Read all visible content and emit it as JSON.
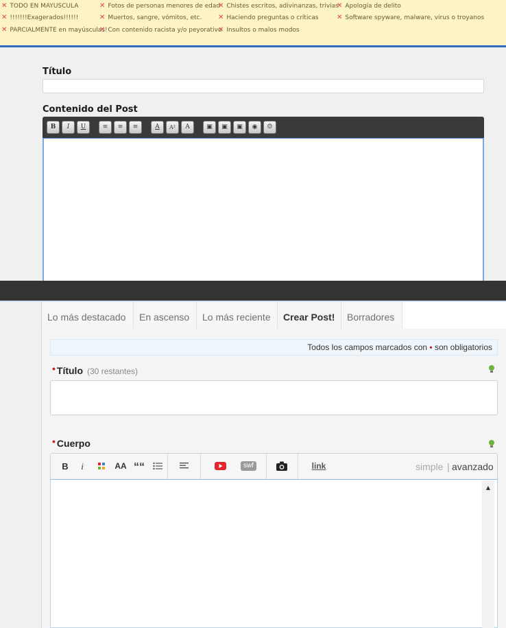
{
  "rules": [
    {
      "text": "TODO EN MAYUSCULA"
    },
    {
      "text": "Fotos de personas menores de edad"
    },
    {
      "text": "Chistes escritos, adivinanzas, trivias"
    },
    {
      "text": "Apología de delito"
    },
    {
      "text": "!!!!!!!Exagerados!!!!!!"
    },
    {
      "text": "Muertos, sangre, vómitos, etc."
    },
    {
      "text": "Haciendo preguntas o críticas"
    },
    {
      "text": "Software spyware, malware, virus o troyanos"
    },
    {
      "text": "PARCIALMENTE en mayúsculas!"
    },
    {
      "text": "Con contenido racista y/o peyorativo"
    },
    {
      "text": "Insultos o malos modos"
    }
  ],
  "old_form": {
    "title_label": "Título",
    "title_value": "",
    "content_label": "Contenido del Post",
    "toolbar": [
      "B",
      "I",
      "U",
      "≡",
      "≡",
      "≡",
      "A",
      "A²",
      "A",
      "▣",
      "▣",
      "▣",
      "◉",
      "☺"
    ]
  },
  "tabs": [
    {
      "label": "Lo más destacado"
    },
    {
      "label": "En ascenso"
    },
    {
      "label": "Lo más reciente"
    },
    {
      "label": "Crear Post!"
    },
    {
      "label": "Borradores"
    }
  ],
  "notice": {
    "before": "Todos los campos marcados con",
    "marker": "•",
    "after": "son obligatorios"
  },
  "new_form": {
    "title_label": "Título",
    "remaining": "(30 restantes)",
    "title_value": "",
    "body_label": "Cuerpo",
    "toolbar": {
      "bold": "B",
      "italic": "i",
      "size": "AA",
      "quote": "““",
      "swf": "swf",
      "link": "link",
      "mode_simple": "simple",
      "mode_divider": "|",
      "mode_advanced": "avanzado"
    },
    "required_marker": "•"
  },
  "colors": {
    "rules_bg": "#fcf3c6",
    "accent_blue": "#2f6dbf",
    "required_red": "#c0272d",
    "youtube_red": "#e2262e",
    "bulb_green": "#6db33f"
  }
}
